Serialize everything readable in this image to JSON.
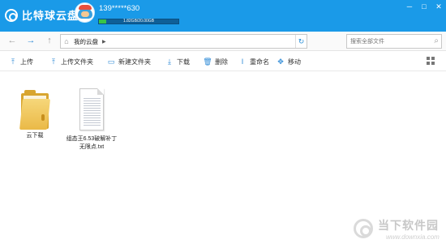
{
  "app": {
    "title": "比特球云盘",
    "account": "139*****630",
    "quota_text": "1.82GB/20.00GB",
    "quota_used_fraction": 0.091,
    "accent_color": "#1a9ae8",
    "window_controls": [
      "─",
      "□",
      "✕"
    ]
  },
  "navbar": {
    "back_icon": "←",
    "forward_icon": "→",
    "up_icon": "↑",
    "home_icon": "⌂",
    "path": "我的云盘",
    "separator": "▶",
    "refresh_icon": "↻",
    "search_placeholder": "搜索全部文件",
    "search_icon": "⌕"
  },
  "toolbar": {
    "items": [
      {
        "icon": "⤒",
        "label": "上传"
      },
      {
        "icon": "⤒",
        "label": "上传文件夹"
      },
      {
        "icon": "▭",
        "label": "新建文件夹"
      },
      {
        "icon": "⤓",
        "label": "下载"
      },
      {
        "icon": "🗑",
        "label": "删除"
      },
      {
        "icon": "I",
        "label": "重命名"
      },
      {
        "icon": "✥",
        "label": "移动"
      }
    ]
  },
  "files": [
    {
      "name": "云下载",
      "type": "folder"
    },
    {
      "name_line1": "组态王6.53破解补丁",
      "name_line2": "无限点.txt",
      "type": "txt"
    }
  ],
  "watermark": {
    "text": "当下软件园",
    "url": "www.downxia.com"
  }
}
